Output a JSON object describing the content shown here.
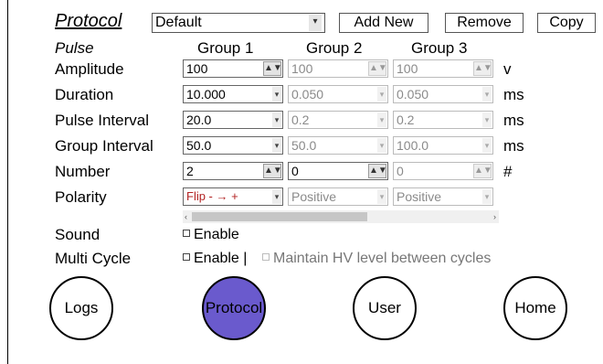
{
  "header": {
    "title": "Protocol",
    "protocol_select": "Default",
    "add_new": "Add New",
    "remove": "Remove",
    "copy": "Copy"
  },
  "pulse_header": "Pulse",
  "groups": [
    "Group 1",
    "Group 2",
    "Group 3"
  ],
  "rows": {
    "amplitude": {
      "label": "Amplitude",
      "values": [
        "100",
        "100",
        "100"
      ],
      "unit": "v"
    },
    "duration": {
      "label": "Duration",
      "values": [
        "10.000",
        "0.050",
        "0.050"
      ],
      "unit": "ms"
    },
    "pulse_interval": {
      "label": "Pulse Interval",
      "values": [
        "20.0",
        "0.2",
        "0.2"
      ],
      "unit": "ms"
    },
    "group_interval": {
      "label": "Group Interval",
      "values": [
        "50.0",
        "50.0",
        "100.0"
      ],
      "unit": "ms"
    },
    "number": {
      "label": "Number",
      "values": [
        "2",
        "0",
        "0"
      ],
      "unit": "#"
    },
    "polarity": {
      "label": "Polarity",
      "values": [
        "Flip - → +",
        "Positive",
        "Positive"
      ]
    }
  },
  "sound": {
    "label": "Sound",
    "checkbox": "Enable"
  },
  "multi_cycle": {
    "label": "Multi Cycle",
    "checkbox": "Enable |",
    "maintain": "Maintain HV level between cycles"
  },
  "nav": {
    "logs": "Logs",
    "protocol": "Protocol",
    "user": "User",
    "home": "Home",
    "active": "protocol"
  },
  "colors": {
    "active_nav": "#6a5acd",
    "polarity_red": "#b22222"
  }
}
